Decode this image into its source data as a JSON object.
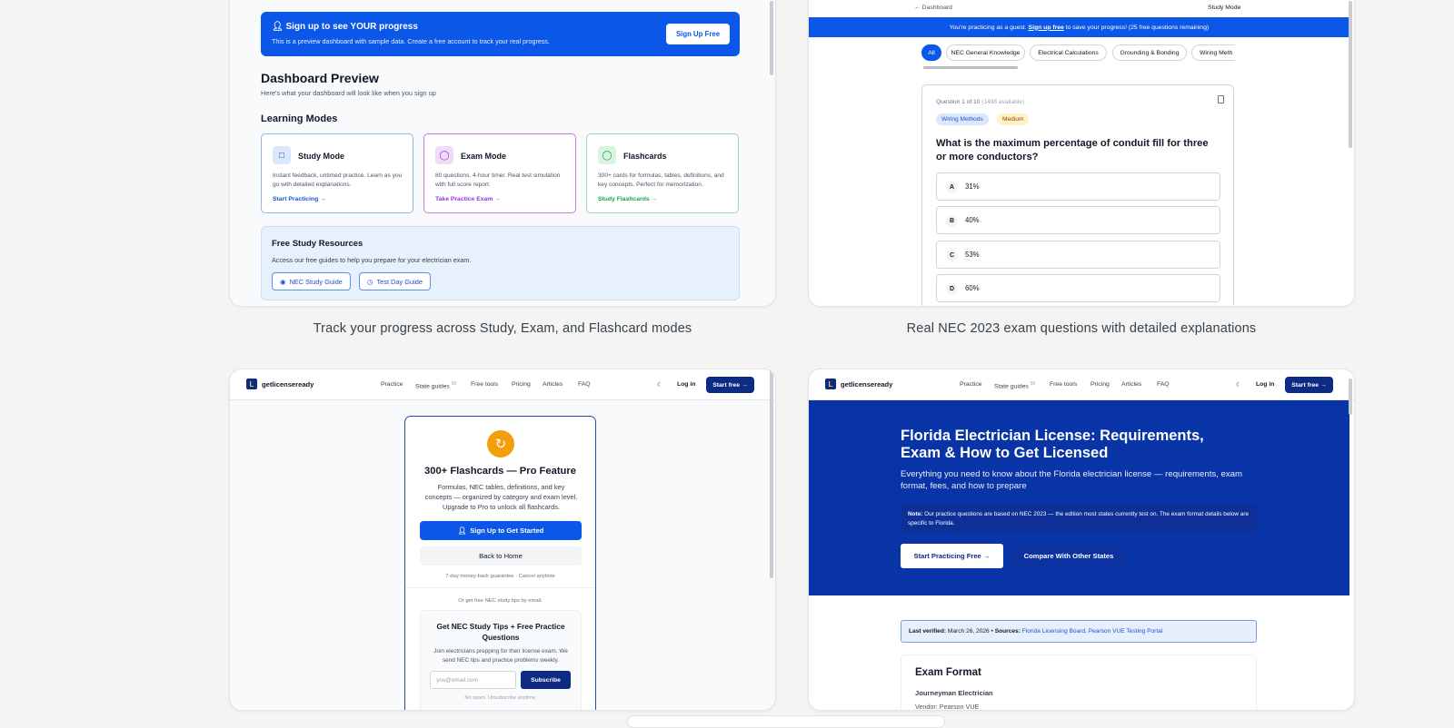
{
  "captions": {
    "c1": "Track your progress across Study, Exam, and Flashcard modes",
    "c2": "Real NEC 2023 exam questions with detailed explanations"
  },
  "dashboard": {
    "banner_title": "Sign up to see YOUR progress",
    "banner_sub": "This is a preview dashboard with sample data. Create a free account to track your real progress.",
    "signup_btn": "Sign Up Free",
    "title": "Dashboard Preview",
    "subtitle": "Here's what your dashboard will look like when you sign up",
    "modes_heading": "Learning Modes",
    "modes": [
      {
        "name": "Study Mode",
        "desc": "Instant feedback, untimed practice. Learn as you go with detailed explanations.",
        "link": "Start Practicing →"
      },
      {
        "name": "Exam Mode",
        "desc": "80 questions, 4-hour timer. Real test simulation with full score report.",
        "link": "Take Practice Exam →"
      },
      {
        "name": "Flashcards",
        "desc": "300+ cards for formulas, tables, definitions, and key concepts. Perfect for memorization.",
        "link": "Study Flashcards →"
      }
    ],
    "resources_title": "Free Study Resources",
    "resources_sub": "Access our free guides to help you prepare for your electrician exam.",
    "res_btn1": "NEC Study Guide",
    "res_btn2": "Test Day Guide"
  },
  "study": {
    "back": "← Dashboard",
    "mode": "Study Mode",
    "guest_pre": "You're practicing as a guest.",
    "guest_link": "Sign up free",
    "guest_post": "to save your progress! (25 free questions remaining)",
    "tabs": [
      "All",
      "NEC General Knowledge",
      "Electrical Calculations",
      "Grounding & Bonding",
      "Wiring Meth"
    ],
    "qnum": "Question 1 of 10",
    "qavail": "(1498 available)",
    "tag1": "Wiring Methods",
    "tag2": "Medium",
    "question": "What is the maximum percentage of conduit fill for three or more conductors?",
    "options": [
      {
        "k": "A",
        "v": "31%"
      },
      {
        "k": "B",
        "v": "40%"
      },
      {
        "k": "C",
        "v": "53%"
      },
      {
        "k": "D",
        "v": "60%"
      }
    ]
  },
  "nav": {
    "brand": "getlicenseready",
    "items": [
      "Practice",
      "State guides",
      "Free tools",
      "Pricing",
      "Articles",
      "FAQ"
    ],
    "state_count": "50",
    "login": "Log in",
    "start": "Start free →"
  },
  "flash": {
    "title": "300+ Flashcards — Pro Feature",
    "desc": "Formulas, NEC tables, definitions, and key concepts — organized by category and exam level. Upgrade to Pro to unlock all flashcards.",
    "signup": "Sign Up to Get Started",
    "back": "Back to Home",
    "guarantee": "7-day money-back guarantee · Cancel anytime",
    "email_note": "Or get free NEC study tips by email:",
    "tips_title": "Get NEC Study Tips + Free Practice Questions",
    "tips_desc": "Join electricians prepping for their license exam. We send NEC tips and practice problems weekly.",
    "email_placeholder": "you@email.com",
    "subscribe": "Subscribe",
    "nospam": "No spam. Unsubscribe anytime."
  },
  "florida": {
    "title": "Florida Electrician License: Requirements, Exam & How to Get Licensed",
    "sub": "Everything you need to know about the Florida electrician license — requirements, exam format, fees, and how to prepare",
    "note_label": "Note:",
    "note": "Our practice questions are based on NEC 2023 — the edition most states currently test on. The exam format details below are specific to Florida.",
    "btn1": "Start Practicing Free →",
    "btn2": "Compare With Other States",
    "verified_label": "Last verified:",
    "verified": "March 26, 2026",
    "sources_label": "Sources:",
    "sources": "Florida Licensing Board, Pearson VUE Testing Portal",
    "exam_heading": "Exam Format",
    "journeyman": "Journeyman Electrician",
    "vendor": "Vendor: Pearson VUE"
  },
  "colors": {
    "primary": "#0b57e8",
    "navy": "#0d2a85",
    "hero": "#0834a8"
  }
}
